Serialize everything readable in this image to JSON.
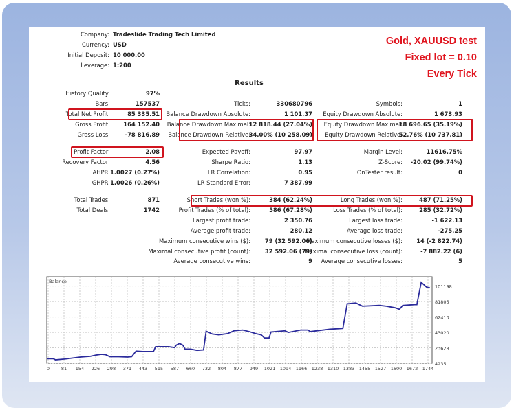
{
  "note": {
    "line1": "Gold, XAUUSD test",
    "line2": "Fixed lot = 0.10",
    "line3": "Every Tick"
  },
  "header": [
    {
      "label": "Company:",
      "value": "Tradeslide Trading Tech Limited"
    },
    {
      "label": "Currency:",
      "value": "USD"
    },
    {
      "label": "Initial Deposit:",
      "value": "10 000.00"
    },
    {
      "label": "Leverage:",
      "value": "1:200"
    }
  ],
  "results_title": "Results",
  "col1": [
    {
      "label": "History Quality:",
      "value": "97%"
    },
    {
      "label": "Bars:",
      "value": "157537"
    },
    {
      "label": "Total Net Profit:",
      "value": "85 335.51"
    },
    {
      "label": "Gross Profit:",
      "value": "164 152.40"
    },
    {
      "label": "Gross Loss:",
      "value": "-78 816.89"
    },
    {
      "label": "Profit Factor:",
      "value": "2.08"
    },
    {
      "label": "Recovery Factor:",
      "value": "4.56"
    },
    {
      "label": "AHPR:",
      "value": "1.0027 (0.27%)"
    },
    {
      "label": "GHPR:",
      "value": "1.0026 (0.26%)"
    },
    {
      "label": "Total Trades:",
      "value": "871"
    },
    {
      "label": "Total Deals:",
      "value": "1742"
    }
  ],
  "col2": [
    {
      "label": "Ticks:",
      "value": "330680796"
    },
    {
      "label": "Balance Drawdown Absolute:",
      "value": "1 101.37"
    },
    {
      "label": "Balance Drawdown Maximal:",
      "value": "12 818.44 (27.04%)"
    },
    {
      "label": "Balance Drawdown Relative:",
      "value": "34.00% (10 258.09)"
    },
    {
      "label": "Expected Payoff:",
      "value": "97.97"
    },
    {
      "label": "Sharpe Ratio:",
      "value": "1.13"
    },
    {
      "label": "LR Correlation:",
      "value": "0.95"
    },
    {
      "label": "LR Standard Error:",
      "value": "7 387.99"
    },
    {
      "label": "Short Trades (won %):",
      "value": "384 (62.24%)"
    },
    {
      "label": "Profit Trades (% of total):",
      "value": "586 (67.28%)"
    },
    {
      "label": "Largest profit trade:",
      "value": "2 350.76"
    },
    {
      "label": "Average profit trade:",
      "value": "280.12"
    },
    {
      "label": "Maximum consecutive wins ($):",
      "value": "79 (32 592.06)"
    },
    {
      "label": "Maximal consecutive profit (count):",
      "value": "32 592.06 (79)"
    },
    {
      "label": "Average consecutive wins:",
      "value": "9"
    }
  ],
  "col3": [
    {
      "label": "Symbols:",
      "value": "1"
    },
    {
      "label": "Equity Drawdown Absolute:",
      "value": "1 673.93"
    },
    {
      "label": "Equity Drawdown Maximal:",
      "value": "18 696.65 (35.19%)"
    },
    {
      "label": "Equity Drawdown Relative:",
      "value": "52.76% (10 737.81)"
    },
    {
      "label": "Margin Level:",
      "value": "11616.75%"
    },
    {
      "label": "Z-Score:",
      "value": "-20.02 (99.74%)"
    },
    {
      "label": "OnTester result:",
      "value": "0"
    },
    {
      "label": "Long Trades (won %):",
      "value": "487 (71.25%)"
    },
    {
      "label": "Loss Trades (% of total):",
      "value": "285 (32.72%)"
    },
    {
      "label": "Largest loss trade:",
      "value": "-1 622.13"
    },
    {
      "label": "Average loss trade:",
      "value": "-275.25"
    },
    {
      "label": "Maximum consecutive losses ($):",
      "value": "14 (-2 822.74)"
    },
    {
      "label": "Maximal consecutive loss (count):",
      "value": "-7 882.22 (6)"
    },
    {
      "label": "Average consecutive losses:",
      "value": "5"
    }
  ],
  "highlight_color": "#d0141e",
  "chart_data": {
    "type": "line",
    "title": "Balance",
    "line_color": "#2b2b9c",
    "grid": true,
    "x_ticks": [
      "0",
      "81",
      "154",
      "226",
      "298",
      "371",
      "443",
      "515",
      "587",
      "660",
      "732",
      "804",
      "877",
      "949",
      "1021",
      "1094",
      "1166",
      "1238",
      "1310",
      "1383",
      "1455",
      "1527",
      "1600",
      "1672",
      "1744"
    ],
    "y_ticks": [
      "4235",
      "23628",
      "43020",
      "62413",
      "81805",
      "101198"
    ],
    "xlim": [
      0,
      1770
    ],
    "ylim": [
      4235,
      113000
    ],
    "series": [
      {
        "x": [
          0,
          30,
          40,
          81,
          110,
          154,
          200,
          226,
          250,
          270,
          290,
          330,
          371,
          390,
          410,
          440,
          490,
          500,
          560,
          587,
          595,
          610,
          625,
          635,
          660,
          690,
          720,
          732,
          760,
          790,
          830,
          860,
          900,
          930,
          960,
          985,
          1000,
          1021,
          1030,
          1094,
          1110,
          1166,
          1200,
          1210,
          1300,
          1360,
          1380,
          1420,
          1450,
          1527,
          1560,
          1600,
          1620,
          1635,
          1690,
          1700,
          1720,
          1744,
          1760
        ],
        "y": [
          10000,
          10000,
          8500,
          9500,
          10500,
          12000,
          13000,
          14500,
          15500,
          15000,
          12500,
          12500,
          12000,
          12500,
          19500,
          19000,
          19000,
          25000,
          25000,
          24000,
          27000,
          29000,
          27000,
          22000,
          22000,
          20500,
          21000,
          44500,
          41000,
          40000,
          41500,
          45000,
          46000,
          44000,
          41500,
          40000,
          36000,
          36000,
          43500,
          45000,
          43000,
          46000,
          46000,
          44000,
          47000,
          48000,
          79000,
          80000,
          76000,
          77000,
          76000,
          74000,
          72000,
          77000,
          78000,
          78000,
          106000,
          100000,
          99000
        ]
      }
    ]
  }
}
